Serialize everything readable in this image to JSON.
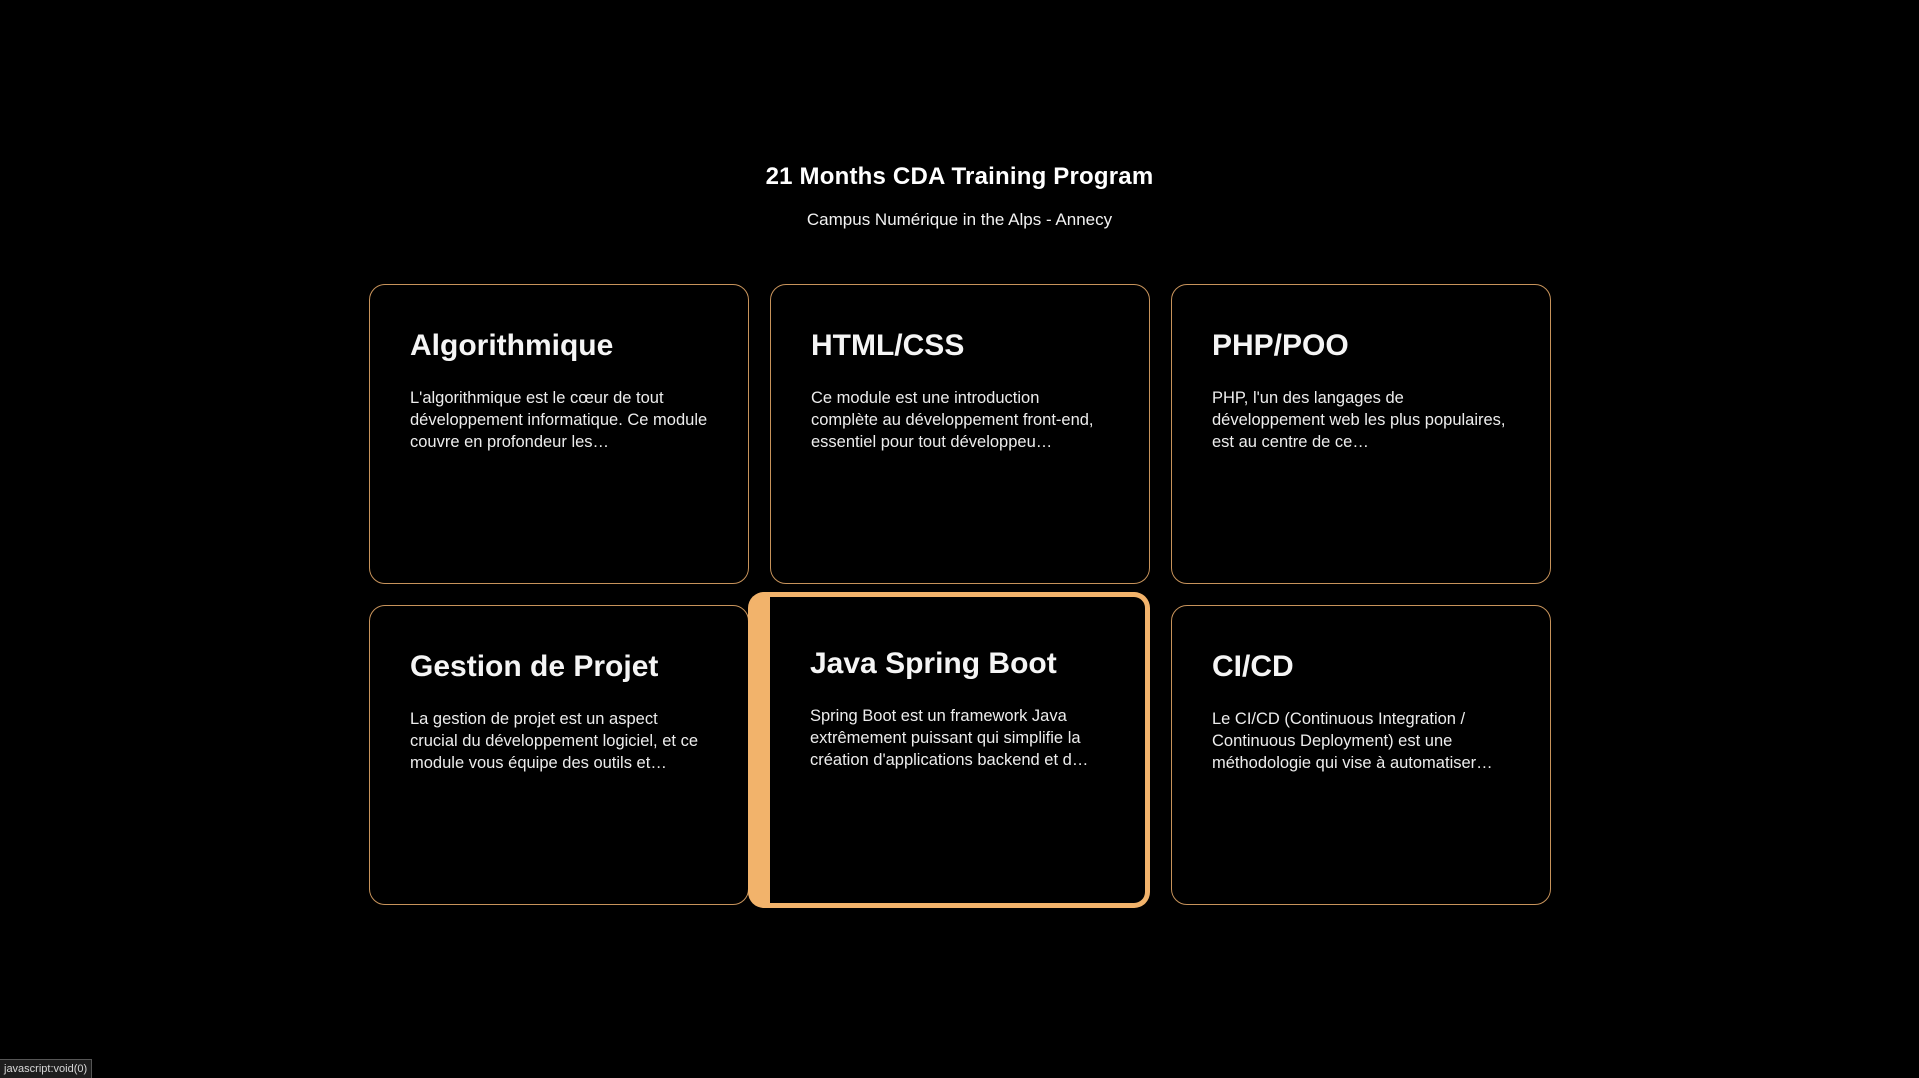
{
  "header": {
    "title": "21 Months CDA Training Program",
    "subtitle": "Campus Numérique in the Alps - Annecy"
  },
  "colors": {
    "background": "#000000",
    "card_border": "#c7935b",
    "card_active_border": "#f2b36b"
  },
  "cards": [
    {
      "title": "Algorithmique",
      "description": "L'algorithmique est le cœur de tout développement informatique. Ce module couvre en profondeur les…"
    },
    {
      "title": "HTML/CSS",
      "description": "Ce module est une introduction complète au développement front-end, essentiel pour tout développeu…"
    },
    {
      "title": "PHP/POO",
      "description": "PHP, l'un des langages de développement web les plus populaires, est au centre de ce…"
    },
    {
      "title": "Gestion de Projet",
      "description": "La gestion de projet est un aspect crucial du développement logiciel, et ce module vous équipe des outils et…"
    },
    {
      "title": "Java Spring Boot",
      "description": "Spring Boot est un framework Java extrêmement puissant qui simplifie la création d'applications backend et d…"
    },
    {
      "title": "CI/CD",
      "description": "Le CI/CD (Continuous Integration / Continuous Deployment) est une méthodologie qui vise à automatiser…"
    }
  ],
  "status_bar": {
    "text": "javascript:void(0)"
  }
}
